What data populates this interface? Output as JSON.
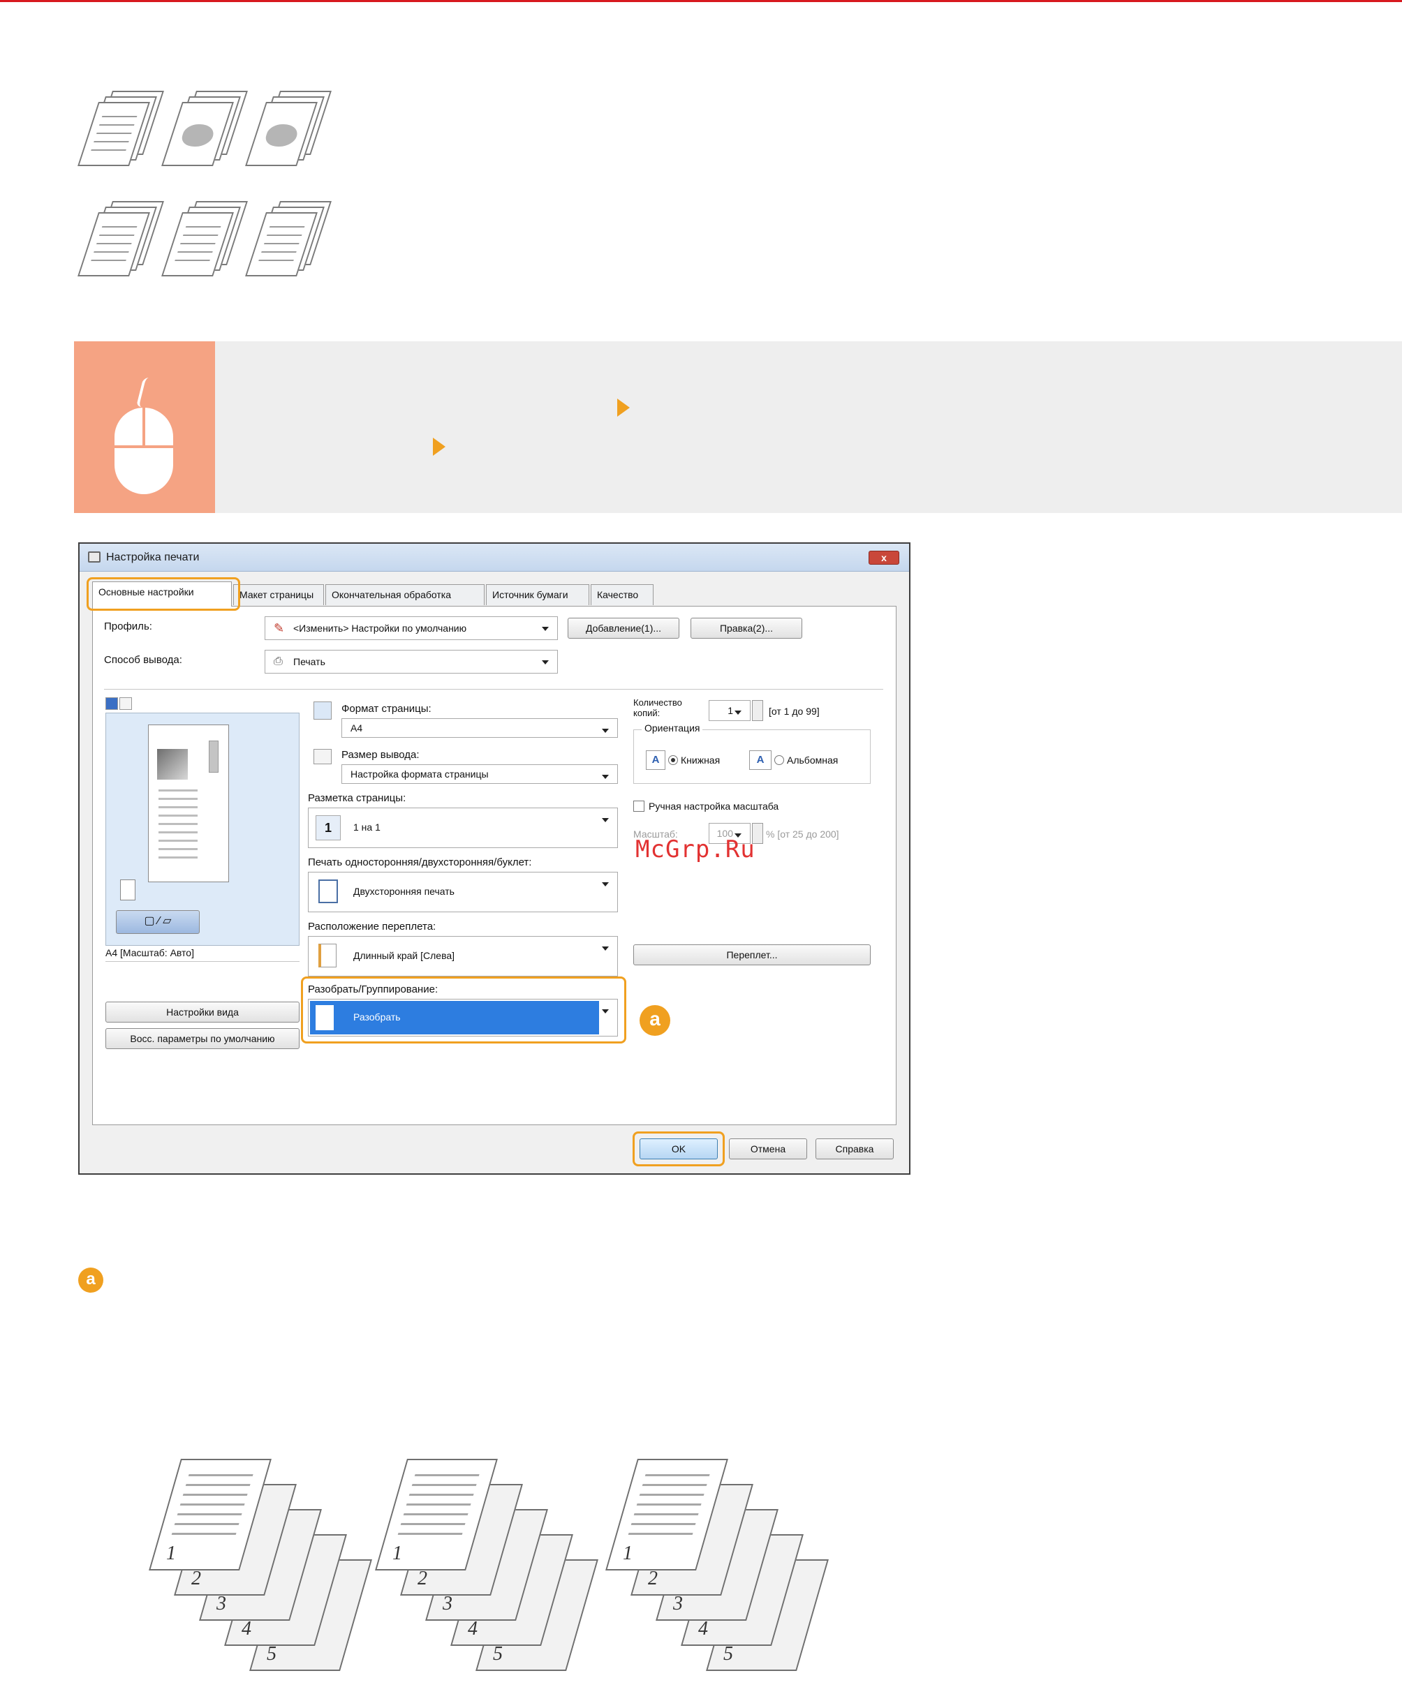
{
  "watermark": "McGrp.Ru",
  "marker_letter": "a",
  "dialog": {
    "title": "Настройка печати",
    "close_label": "x",
    "tabs": [
      {
        "label": "Основные настройки"
      },
      {
        "label": "Макет страницы"
      },
      {
        "label": "Окончательная обработка"
      },
      {
        "label": "Источник бумаги"
      },
      {
        "label": "Качество"
      }
    ],
    "profile": {
      "label": "Профиль:",
      "value": "<Изменить> Настройки по умолчанию",
      "add_button": "Добавление(1)...",
      "edit_button": "Правка(2)..."
    },
    "output": {
      "label": "Способ вывода:",
      "value": "Печать"
    },
    "preview_caption": "A4 [Масштаб: Авто]",
    "view_settings_button": "Настройки вида",
    "restore_defaults_button": "Восс. параметры по умолчанию",
    "page_size": {
      "label": "Формат страницы:",
      "value": "A4"
    },
    "output_size": {
      "label": "Размер вывода:",
      "value": "Настройка формата страницы"
    },
    "page_layout": {
      "label": "Разметка страницы:",
      "value": "1 на 1",
      "icon_number": "1"
    },
    "duplex": {
      "label": "Печать односторонняя/двухсторонняя/буклет:",
      "value": "Двухсторонняя печать"
    },
    "binding": {
      "label": "Расположение переплета:",
      "value": "Длинный край [Слева]",
      "button": "Переплет..."
    },
    "collate": {
      "label": "Разобрать/Группирование:",
      "value": "Разобрать"
    },
    "copies": {
      "label": "Количество копий:",
      "value": "1",
      "range": "[от 1 до 99]"
    },
    "orientation": {
      "label": "Ориентация",
      "portrait": "Книжная",
      "landscape": "Альбомная",
      "icon_letter": "A"
    },
    "manual_scaling": {
      "label": "Ручная настройка масштаба"
    },
    "scaling": {
      "label": "Масштаб:",
      "value": "100",
      "range": "% [от 25 до 200]"
    },
    "buttons": {
      "ok": "OK",
      "cancel": "Отмена",
      "help": "Справка"
    }
  },
  "collated_sets": [
    {
      "pages": [
        "1",
        "2",
        "3",
        "4",
        "5"
      ]
    },
    {
      "pages": [
        "1",
        "2",
        "3",
        "4",
        "5"
      ]
    },
    {
      "pages": [
        "1",
        "2",
        "3",
        "4",
        "5"
      ]
    }
  ]
}
